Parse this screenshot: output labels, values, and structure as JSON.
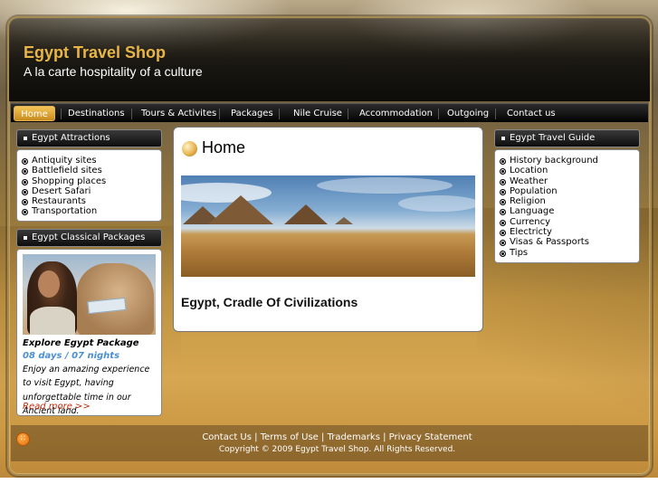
{
  "site": {
    "title": "Egypt Travel Shop",
    "tagline": "A la carte hospitality of a culture"
  },
  "nav": {
    "items": [
      "Home",
      "Destinations",
      "Tours & Activites",
      "Packages",
      "Nile Cruise",
      "Accommodation",
      "Outgoing",
      "Contact us"
    ],
    "active": "Home"
  },
  "attractions": {
    "heading": "Egypt Attractions",
    "items": [
      "Antiquity sites",
      "Battlefield sites",
      "Shopping places",
      "Desert Safari",
      "Restaurants",
      "Transportation"
    ]
  },
  "packages": {
    "heading": "Egypt Classical Packages",
    "title": "Explore Egypt Package",
    "duration": "08 days / 07 nights",
    "description": "Enjoy an amazing experience to visit Egypt, having unforgettable time in our Ancient land.",
    "more": "Read more >>"
  },
  "main": {
    "title": "Home",
    "caption": "Egypt, Cradle Of Civilizations"
  },
  "guide": {
    "heading": "Egypt Travel Guide",
    "items": [
      "History background",
      "Location",
      "Weather",
      "Population",
      "Religion",
      "Language",
      "Currency",
      "Electricty",
      "Visas & Passports",
      "Tips"
    ]
  },
  "footer": {
    "links": [
      "Contact Us",
      "Terms of Use",
      "Trademarks",
      "Privacy Statement"
    ],
    "separator": " | ",
    "copyright": "Copyright © 2009 Egypt Travel Shop. All Rights Reserved."
  },
  "colors": {
    "accent": "#e8b547",
    "nav_active": "#e0a83a",
    "link_red": "#c02a0c",
    "duration_blue": "#4a8fd2"
  }
}
